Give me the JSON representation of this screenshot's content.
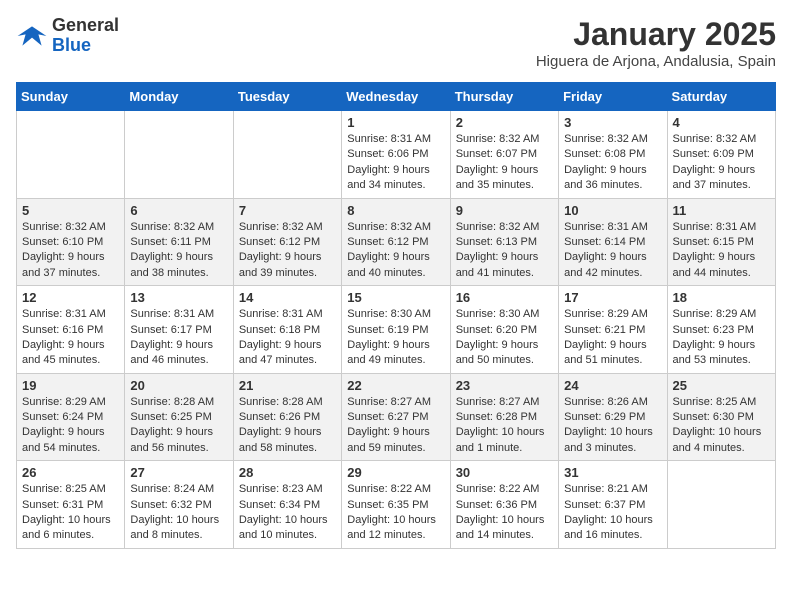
{
  "header": {
    "logo_line1": "General",
    "logo_line2": "Blue",
    "month": "January 2025",
    "location": "Higuera de Arjona, Andalusia, Spain"
  },
  "weekdays": [
    "Sunday",
    "Monday",
    "Tuesday",
    "Wednesday",
    "Thursday",
    "Friday",
    "Saturday"
  ],
  "weeks": [
    [
      {
        "day": "",
        "info": ""
      },
      {
        "day": "",
        "info": ""
      },
      {
        "day": "",
        "info": ""
      },
      {
        "day": "1",
        "info": "Sunrise: 8:31 AM\nSunset: 6:06 PM\nDaylight: 9 hours and 34 minutes."
      },
      {
        "day": "2",
        "info": "Sunrise: 8:32 AM\nSunset: 6:07 PM\nDaylight: 9 hours and 35 minutes."
      },
      {
        "day": "3",
        "info": "Sunrise: 8:32 AM\nSunset: 6:08 PM\nDaylight: 9 hours and 36 minutes."
      },
      {
        "day": "4",
        "info": "Sunrise: 8:32 AM\nSunset: 6:09 PM\nDaylight: 9 hours and 37 minutes."
      }
    ],
    [
      {
        "day": "5",
        "info": "Sunrise: 8:32 AM\nSunset: 6:10 PM\nDaylight: 9 hours and 37 minutes."
      },
      {
        "day": "6",
        "info": "Sunrise: 8:32 AM\nSunset: 6:11 PM\nDaylight: 9 hours and 38 minutes."
      },
      {
        "day": "7",
        "info": "Sunrise: 8:32 AM\nSunset: 6:12 PM\nDaylight: 9 hours and 39 minutes."
      },
      {
        "day": "8",
        "info": "Sunrise: 8:32 AM\nSunset: 6:12 PM\nDaylight: 9 hours and 40 minutes."
      },
      {
        "day": "9",
        "info": "Sunrise: 8:32 AM\nSunset: 6:13 PM\nDaylight: 9 hours and 41 minutes."
      },
      {
        "day": "10",
        "info": "Sunrise: 8:31 AM\nSunset: 6:14 PM\nDaylight: 9 hours and 42 minutes."
      },
      {
        "day": "11",
        "info": "Sunrise: 8:31 AM\nSunset: 6:15 PM\nDaylight: 9 hours and 44 minutes."
      }
    ],
    [
      {
        "day": "12",
        "info": "Sunrise: 8:31 AM\nSunset: 6:16 PM\nDaylight: 9 hours and 45 minutes."
      },
      {
        "day": "13",
        "info": "Sunrise: 8:31 AM\nSunset: 6:17 PM\nDaylight: 9 hours and 46 minutes."
      },
      {
        "day": "14",
        "info": "Sunrise: 8:31 AM\nSunset: 6:18 PM\nDaylight: 9 hours and 47 minutes."
      },
      {
        "day": "15",
        "info": "Sunrise: 8:30 AM\nSunset: 6:19 PM\nDaylight: 9 hours and 49 minutes."
      },
      {
        "day": "16",
        "info": "Sunrise: 8:30 AM\nSunset: 6:20 PM\nDaylight: 9 hours and 50 minutes."
      },
      {
        "day": "17",
        "info": "Sunrise: 8:29 AM\nSunset: 6:21 PM\nDaylight: 9 hours and 51 minutes."
      },
      {
        "day": "18",
        "info": "Sunrise: 8:29 AM\nSunset: 6:23 PM\nDaylight: 9 hours and 53 minutes."
      }
    ],
    [
      {
        "day": "19",
        "info": "Sunrise: 8:29 AM\nSunset: 6:24 PM\nDaylight: 9 hours and 54 minutes."
      },
      {
        "day": "20",
        "info": "Sunrise: 8:28 AM\nSunset: 6:25 PM\nDaylight: 9 hours and 56 minutes."
      },
      {
        "day": "21",
        "info": "Sunrise: 8:28 AM\nSunset: 6:26 PM\nDaylight: 9 hours and 58 minutes."
      },
      {
        "day": "22",
        "info": "Sunrise: 8:27 AM\nSunset: 6:27 PM\nDaylight: 9 hours and 59 minutes."
      },
      {
        "day": "23",
        "info": "Sunrise: 8:27 AM\nSunset: 6:28 PM\nDaylight: 10 hours and 1 minute."
      },
      {
        "day": "24",
        "info": "Sunrise: 8:26 AM\nSunset: 6:29 PM\nDaylight: 10 hours and 3 minutes."
      },
      {
        "day": "25",
        "info": "Sunrise: 8:25 AM\nSunset: 6:30 PM\nDaylight: 10 hours and 4 minutes."
      }
    ],
    [
      {
        "day": "26",
        "info": "Sunrise: 8:25 AM\nSunset: 6:31 PM\nDaylight: 10 hours and 6 minutes."
      },
      {
        "day": "27",
        "info": "Sunrise: 8:24 AM\nSunset: 6:32 PM\nDaylight: 10 hours and 8 minutes."
      },
      {
        "day": "28",
        "info": "Sunrise: 8:23 AM\nSunset: 6:34 PM\nDaylight: 10 hours and 10 minutes."
      },
      {
        "day": "29",
        "info": "Sunrise: 8:22 AM\nSunset: 6:35 PM\nDaylight: 10 hours and 12 minutes."
      },
      {
        "day": "30",
        "info": "Sunrise: 8:22 AM\nSunset: 6:36 PM\nDaylight: 10 hours and 14 minutes."
      },
      {
        "day": "31",
        "info": "Sunrise: 8:21 AM\nSunset: 6:37 PM\nDaylight: 10 hours and 16 minutes."
      },
      {
        "day": "",
        "info": ""
      }
    ]
  ]
}
